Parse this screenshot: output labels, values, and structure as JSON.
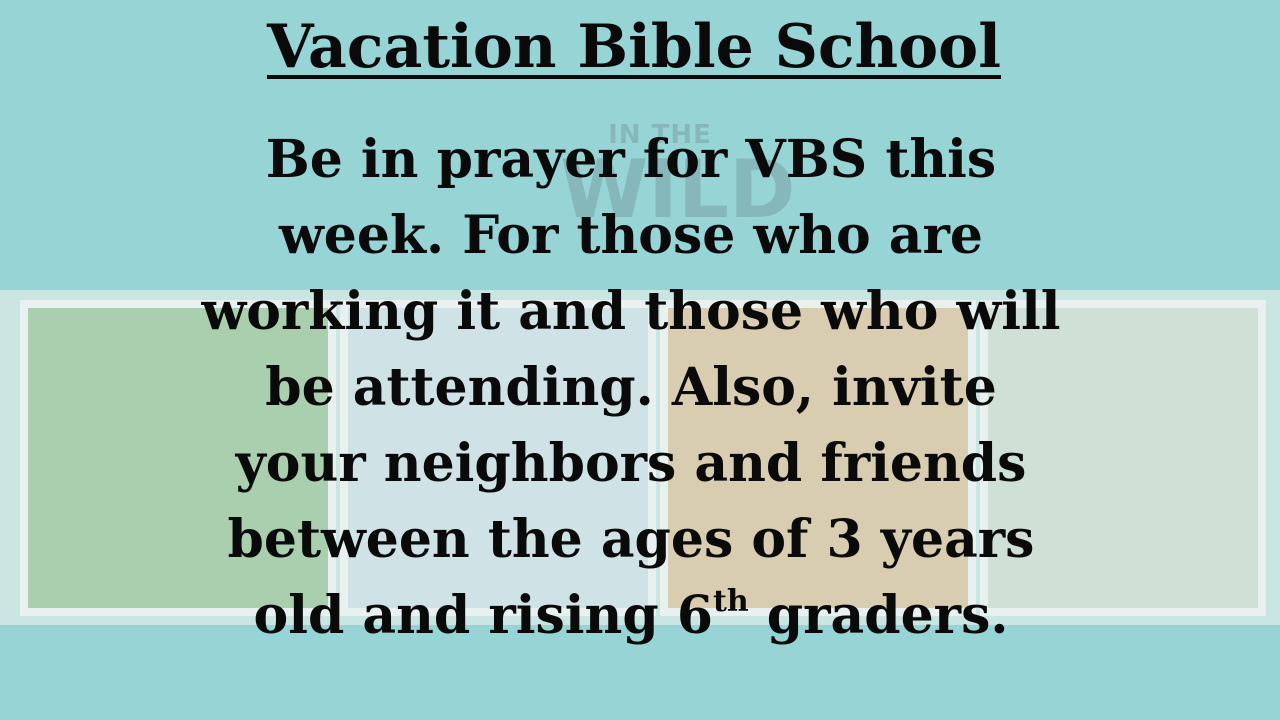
{
  "title": "Vacation Bible School",
  "background_logo": [
    "IN THE",
    "WILD"
  ],
  "body_lines": [
    "Be in prayer for VBS this",
    "week.  For those who are",
    "working it and those who will",
    "be attending.  Also, invite",
    "your neighbors and friends",
    "between the ages of 3 years"
  ],
  "last_line": {
    "before": "old and rising 6",
    "superscript": "th",
    "after": " graders."
  },
  "colors": {
    "background": "#97d4d6",
    "text": "#0a0a0a"
  }
}
